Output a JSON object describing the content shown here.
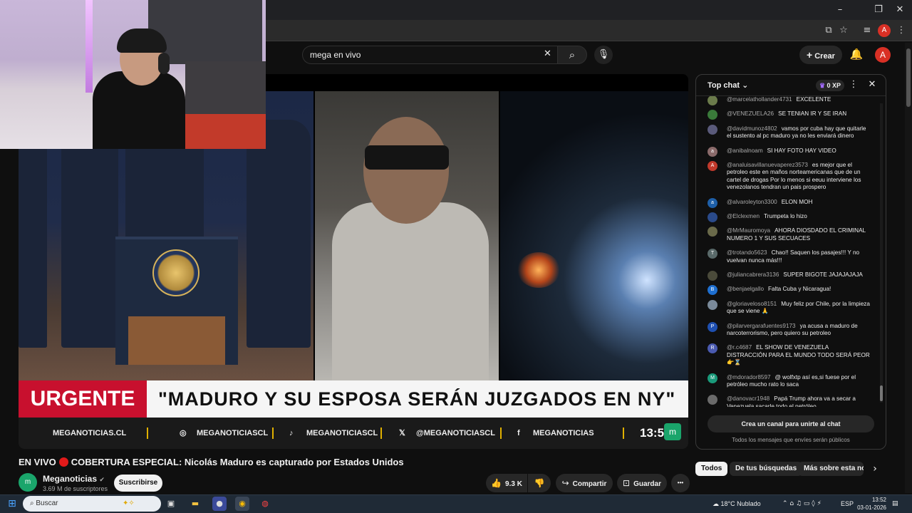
{
  "browser": {
    "minimize": "–",
    "maximize": "❐",
    "close": "✕",
    "profile_initial": "A"
  },
  "header": {
    "search_value": "mega en vivo",
    "create_label": "Crear",
    "avatar_initial": "A"
  },
  "video": {
    "urgente_label": "URGENTE",
    "headline": "\"MADURO Y SU ESPOSA SERÁN JUZGADOS EN NY\"",
    "social": {
      "web": "MEGANOTICIAS.CL",
      "instagram": "MEGANOTICIASCL",
      "tiktok": "MEGANOTICIASCL",
      "x": "@MEGANOTICIASCL",
      "facebook": "MEGANOTICIAS"
    },
    "clock": "13:5",
    "title_prefix": "EN VIVO",
    "title_text": "COBERTURA ESPECIAL: Nicolás Maduro es capturado por Estados Unidos"
  },
  "channel": {
    "name": "Meganoticias",
    "verified": "✔",
    "subscribers": "3.69 M de suscriptores",
    "subscribe_label": "Suscribirse"
  },
  "actions": {
    "likes": "9.3 K",
    "share": "Compartir",
    "save": "Guardar",
    "more": "•••"
  },
  "chat": {
    "title": "Top chat",
    "xp": "0 XP",
    "messages": [
      {
        "author": "@marcelathollander4731",
        "text": "EXCELENTE",
        "color": "#6b7b4b",
        "initial": ""
      },
      {
        "author": "@VENEZUELA26",
        "text": "SE TENIAN IR Y SE IRAN",
        "color": "#3a7a3a",
        "initial": ""
      },
      {
        "author": "@davidmunoz4802",
        "text": "vamos por cuba hay que quitarle el sustento al pc maduro ya no les enviará dinero",
        "color": "#5a5a7a",
        "initial": ""
      },
      {
        "author": "@anibalnoam",
        "text": "SI HAY FOTO HAY VIDEO",
        "color": "#8a6a6a",
        "initial": "a"
      },
      {
        "author": "@analuisavillanuevaperez3573",
        "text": "es mejor que el petroleo este en maños norteamericanas que de un cartel de drogas Por lo menos si eeuu interviene los venezolanos tendran un pais prospero",
        "color": "#c0392b",
        "initial": "A"
      },
      {
        "author": "@alvaroleyton3300",
        "text": "ELON MOH",
        "color": "#1e5fa8",
        "initial": "a"
      },
      {
        "author": "@Elclexmen",
        "text": "Trumpeta lo hizo",
        "color": "#2a4a8a",
        "initial": ""
      },
      {
        "author": "@MrMauromoya",
        "text": "AHORA DIOSDADO EL CRIMINAL NUMERO 1 Y SUS SECUACES",
        "color": "#6a6a4a",
        "initial": ""
      },
      {
        "author": "@trotando5623",
        "text": "Chao!! Saquen los pasajes!!! Y no vuelvan nunca más!!!",
        "color": "#5a6a6a",
        "initial": "T"
      },
      {
        "author": "@juliancabrera3136",
        "text": "SUPER BIGOTE JAJAJAJAJA",
        "color": "#4a4a3a",
        "initial": ""
      },
      {
        "author": "@benjaelgallo",
        "text": "Falta Cuba y Nicaragua!",
        "color": "#1e6fd0",
        "initial": "B"
      },
      {
        "author": "@gloriaveloso8151",
        "text": "Muy feliz por Chile, por la limpieza que se viene 🙏",
        "color": "#7a8a9a",
        "initial": ""
      },
      {
        "author": "@pilarvergarafuentes9173",
        "text": "ya acusa a maduro de narcoterrorismo, pero quiero su petroleo",
        "color": "#1e4fb0",
        "initial": "P"
      },
      {
        "author": "@r.c4687",
        "text": "EL SHOW DE VENEZUELA DISTRACCIÓN PARA EL MUNDO TODO SERÁ PEOR 👉⌛",
        "color": "#4a5ab0",
        "initial": "R"
      },
      {
        "author": "@mdorador8597",
        "text": "@ wolfxtp así es,si fuese por el petróleo mucho rato lo saca",
        "color": "#1a9a7a",
        "initial": "M"
      },
      {
        "author": "@danovacr1948",
        "text": "Papá Trump ahora va a secar a Venezuela sacarle todo el petróleo",
        "color": "#6a6a6a",
        "initial": ""
      }
    ],
    "cta": "Crea un canal para unirte al chat",
    "note": "Todos los mensajes que envíes serán públicos"
  },
  "chips": [
    "Todos",
    "De tus búsquedas",
    "Más sobre esta not"
  ],
  "taskbar": {
    "search_placeholder": "Buscar",
    "weather": "18°C  Nublado",
    "lang": "ESP",
    "time": "13:52",
    "date": "03-01-2026"
  }
}
